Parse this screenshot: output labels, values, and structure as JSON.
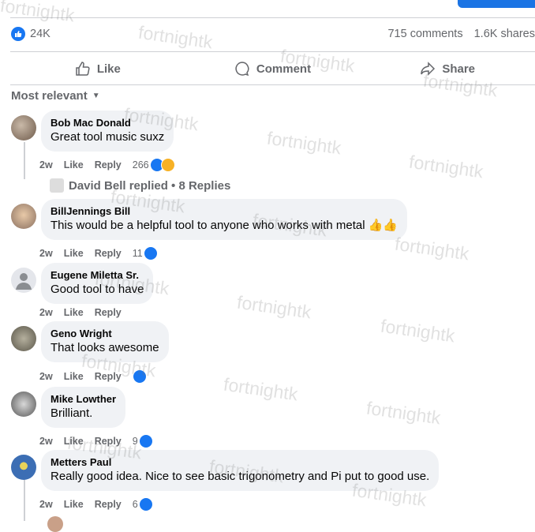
{
  "post_stats": {
    "likes": "24K",
    "comments": "715 comments",
    "shares": "1.6K shares"
  },
  "actions": {
    "like": "Like",
    "comment": "Comment",
    "share": "Share"
  },
  "sort": {
    "label": "Most relevant"
  },
  "watermark": "fortnightk",
  "comments": [
    {
      "name": "Bob Mac Donald",
      "text": "Great tool music suxz",
      "time": "2w",
      "like": "Like",
      "reply": "Reply",
      "reactions": "266",
      "reaction_types": [
        "like",
        "haha"
      ]
    },
    {
      "name": "BillJennings Bill",
      "text": "This would be a helpful tool to anyone who works with metal 👍👍",
      "time": "2w",
      "like": "Like",
      "reply": "Reply",
      "reactions": "11",
      "reaction_types": [
        "like"
      ]
    },
    {
      "name": "Eugene Miletta Sr.",
      "text": "Good tool to have",
      "time": "2w",
      "like": "Like",
      "reply": "Reply",
      "reactions": "",
      "reaction_types": []
    },
    {
      "name": "Geno Wright",
      "text": "That looks awesome",
      "time": "2w",
      "like": "Like",
      "reply": "Reply",
      "reactions": "",
      "reaction_types": [
        "like"
      ]
    },
    {
      "name": "Mike Lowther",
      "text": "Brilliant.",
      "time": "2w",
      "like": "Like",
      "reply": "Reply",
      "reactions": "9",
      "reaction_types": [
        "like"
      ]
    },
    {
      "name": "Metters Paul",
      "text": "Really good idea. Nice to see basic trigonometry and Pi put to good use.",
      "time": "2w",
      "like": "Like",
      "reply": "Reply",
      "reactions": "6",
      "reaction_types": [
        "like"
      ]
    }
  ],
  "replies_summary": {
    "label": "David Bell replied • 8 Replies"
  }
}
